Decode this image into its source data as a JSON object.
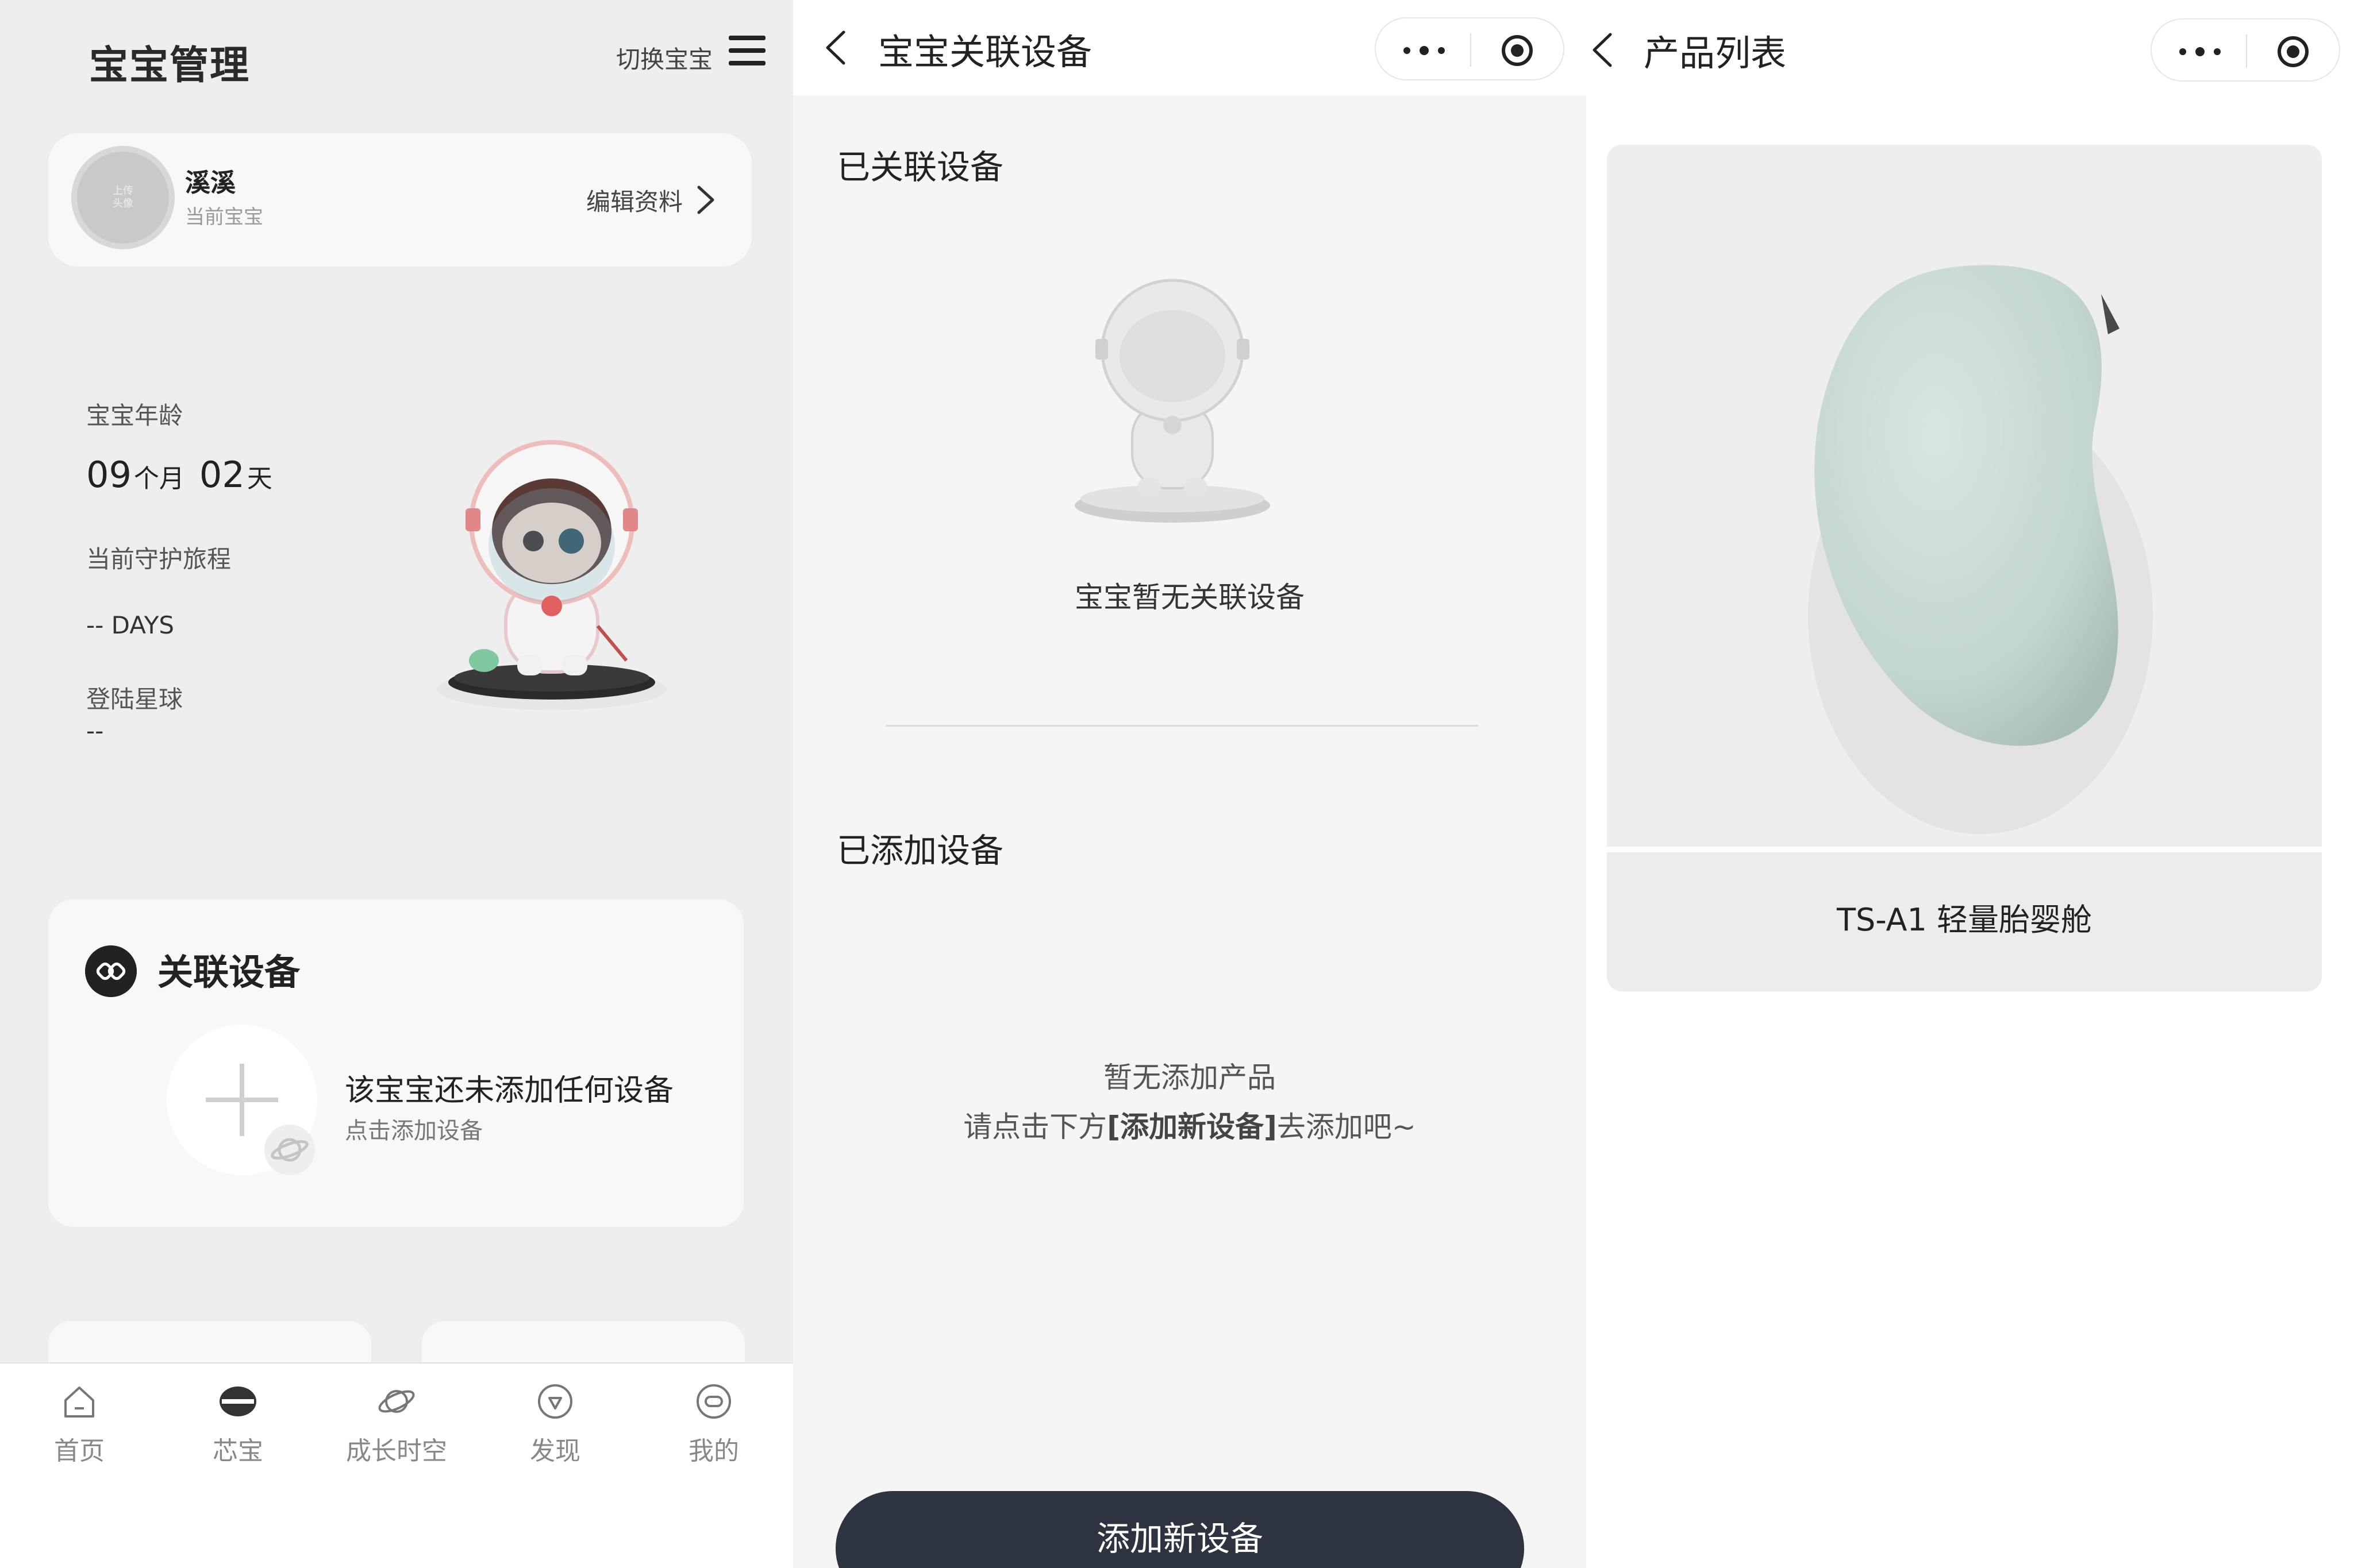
{
  "panel1": {
    "title": "宝宝管理",
    "switch_label": "切换宝宝",
    "profile": {
      "avatar_text_line1": "上传",
      "avatar_text_line2": "头像",
      "name": "溪溪",
      "subtitle": "当前宝宝",
      "edit_label": "编辑资料"
    },
    "stats": {
      "age_label": "宝宝年龄",
      "age_months": "09",
      "months_unit": "个月",
      "age_days": "02",
      "days_unit": "天",
      "journey_label": "当前守护旅程",
      "journey_value": "--  DAYS",
      "planet_label": "登陆星球",
      "planet_value": "--"
    },
    "device_card": {
      "title": "关联设备",
      "empty_text": "该宝宝还未添加任何设备",
      "add_hint": "点击添加设备"
    },
    "tabs": [
      {
        "label": "首页",
        "icon": "home-icon"
      },
      {
        "label": "芯宝",
        "icon": "xinbao-icon"
      },
      {
        "label": "成长时空",
        "icon": "planet-icon"
      },
      {
        "label": "发现",
        "icon": "discover-icon"
      },
      {
        "label": "我的",
        "icon": "profile-icon"
      }
    ]
  },
  "panel2": {
    "title": "宝宝关联设备",
    "linked_section": "已关联设备",
    "no_linked": "宝宝暂无关联设备",
    "added_section": "已添加设备",
    "no_product": "暂无添加产品",
    "hint_prefix": "请点击下方",
    "hint_bold": "[添加新设备]",
    "hint_suffix": "去添加吧~",
    "add_button": "添加新设备"
  },
  "panel3": {
    "title": "产品列表",
    "products": [
      {
        "name": "TS-A1 轻量胎婴舱"
      }
    ]
  },
  "colors": {
    "accent_dark": "#2e3340",
    "panel_bg": "#eeeeee",
    "card_bg": "#f8f8f8",
    "product_color": "#c8d8d4"
  }
}
